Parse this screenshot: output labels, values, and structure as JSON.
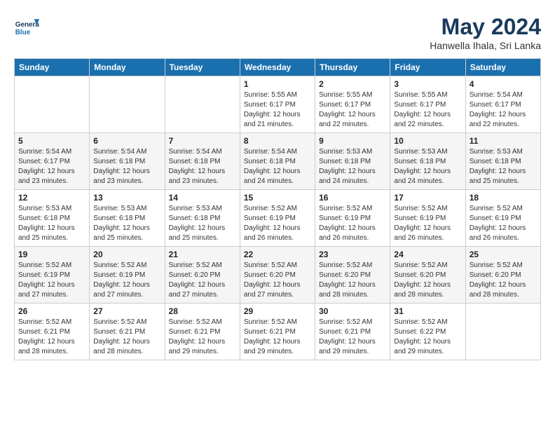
{
  "header": {
    "logo_line1": "General",
    "logo_line2": "Blue",
    "month_title": "May 2024",
    "location": "Hanwella Ihala, Sri Lanka"
  },
  "days_of_week": [
    "Sunday",
    "Monday",
    "Tuesday",
    "Wednesday",
    "Thursday",
    "Friday",
    "Saturday"
  ],
  "weeks": [
    [
      {
        "day": "",
        "info": ""
      },
      {
        "day": "",
        "info": ""
      },
      {
        "day": "",
        "info": ""
      },
      {
        "day": "1",
        "info": "Sunrise: 5:55 AM\nSunset: 6:17 PM\nDaylight: 12 hours\nand 21 minutes."
      },
      {
        "day": "2",
        "info": "Sunrise: 5:55 AM\nSunset: 6:17 PM\nDaylight: 12 hours\nand 22 minutes."
      },
      {
        "day": "3",
        "info": "Sunrise: 5:55 AM\nSunset: 6:17 PM\nDaylight: 12 hours\nand 22 minutes."
      },
      {
        "day": "4",
        "info": "Sunrise: 5:54 AM\nSunset: 6:17 PM\nDaylight: 12 hours\nand 22 minutes."
      }
    ],
    [
      {
        "day": "5",
        "info": "Sunrise: 5:54 AM\nSunset: 6:17 PM\nDaylight: 12 hours\nand 23 minutes."
      },
      {
        "day": "6",
        "info": "Sunrise: 5:54 AM\nSunset: 6:18 PM\nDaylight: 12 hours\nand 23 minutes."
      },
      {
        "day": "7",
        "info": "Sunrise: 5:54 AM\nSunset: 6:18 PM\nDaylight: 12 hours\nand 23 minutes."
      },
      {
        "day": "8",
        "info": "Sunrise: 5:54 AM\nSunset: 6:18 PM\nDaylight: 12 hours\nand 24 minutes."
      },
      {
        "day": "9",
        "info": "Sunrise: 5:53 AM\nSunset: 6:18 PM\nDaylight: 12 hours\nand 24 minutes."
      },
      {
        "day": "10",
        "info": "Sunrise: 5:53 AM\nSunset: 6:18 PM\nDaylight: 12 hours\nand 24 minutes."
      },
      {
        "day": "11",
        "info": "Sunrise: 5:53 AM\nSunset: 6:18 PM\nDaylight: 12 hours\nand 25 minutes."
      }
    ],
    [
      {
        "day": "12",
        "info": "Sunrise: 5:53 AM\nSunset: 6:18 PM\nDaylight: 12 hours\nand 25 minutes."
      },
      {
        "day": "13",
        "info": "Sunrise: 5:53 AM\nSunset: 6:18 PM\nDaylight: 12 hours\nand 25 minutes."
      },
      {
        "day": "14",
        "info": "Sunrise: 5:53 AM\nSunset: 6:18 PM\nDaylight: 12 hours\nand 25 minutes."
      },
      {
        "day": "15",
        "info": "Sunrise: 5:52 AM\nSunset: 6:19 PM\nDaylight: 12 hours\nand 26 minutes."
      },
      {
        "day": "16",
        "info": "Sunrise: 5:52 AM\nSunset: 6:19 PM\nDaylight: 12 hours\nand 26 minutes."
      },
      {
        "day": "17",
        "info": "Sunrise: 5:52 AM\nSunset: 6:19 PM\nDaylight: 12 hours\nand 26 minutes."
      },
      {
        "day": "18",
        "info": "Sunrise: 5:52 AM\nSunset: 6:19 PM\nDaylight: 12 hours\nand 26 minutes."
      }
    ],
    [
      {
        "day": "19",
        "info": "Sunrise: 5:52 AM\nSunset: 6:19 PM\nDaylight: 12 hours\nand 27 minutes."
      },
      {
        "day": "20",
        "info": "Sunrise: 5:52 AM\nSunset: 6:19 PM\nDaylight: 12 hours\nand 27 minutes."
      },
      {
        "day": "21",
        "info": "Sunrise: 5:52 AM\nSunset: 6:20 PM\nDaylight: 12 hours\nand 27 minutes."
      },
      {
        "day": "22",
        "info": "Sunrise: 5:52 AM\nSunset: 6:20 PM\nDaylight: 12 hours\nand 27 minutes."
      },
      {
        "day": "23",
        "info": "Sunrise: 5:52 AM\nSunset: 6:20 PM\nDaylight: 12 hours\nand 28 minutes."
      },
      {
        "day": "24",
        "info": "Sunrise: 5:52 AM\nSunset: 6:20 PM\nDaylight: 12 hours\nand 28 minutes."
      },
      {
        "day": "25",
        "info": "Sunrise: 5:52 AM\nSunset: 6:20 PM\nDaylight: 12 hours\nand 28 minutes."
      }
    ],
    [
      {
        "day": "26",
        "info": "Sunrise: 5:52 AM\nSunset: 6:21 PM\nDaylight: 12 hours\nand 28 minutes."
      },
      {
        "day": "27",
        "info": "Sunrise: 5:52 AM\nSunset: 6:21 PM\nDaylight: 12 hours\nand 28 minutes."
      },
      {
        "day": "28",
        "info": "Sunrise: 5:52 AM\nSunset: 6:21 PM\nDaylight: 12 hours\nand 29 minutes."
      },
      {
        "day": "29",
        "info": "Sunrise: 5:52 AM\nSunset: 6:21 PM\nDaylight: 12 hours\nand 29 minutes."
      },
      {
        "day": "30",
        "info": "Sunrise: 5:52 AM\nSunset: 6:21 PM\nDaylight: 12 hours\nand 29 minutes."
      },
      {
        "day": "31",
        "info": "Sunrise: 5:52 AM\nSunset: 6:22 PM\nDaylight: 12 hours\nand 29 minutes."
      },
      {
        "day": "",
        "info": ""
      }
    ]
  ]
}
